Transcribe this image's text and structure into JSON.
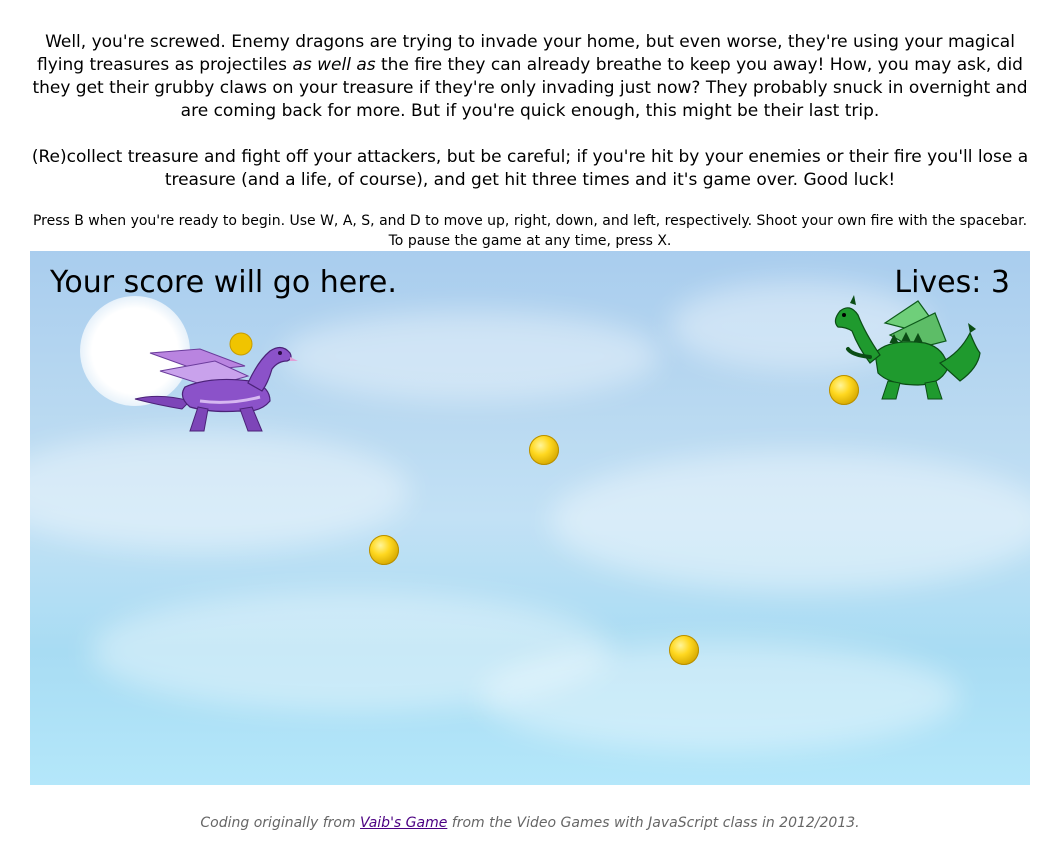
{
  "intro": {
    "p1_before": "Well, you're screwed. Enemy dragons are trying to invade your home, but even worse, they're using your magical flying treasures as projectiles ",
    "p1_emphasis": "as well as",
    "p1_after": " the fire they can already breathe to keep you away! How, you may ask, did they get their grubby claws on your treasure if they're only invading just now? They probably snuck in overnight and are coming back for more. But if you're quick enough, this might be their last trip.",
    "p2": "(Re)collect treasure and fight off your attackers, but be careful; if you're hit by your enemies or their fire you'll lose a treasure (and a life, of course), and get hit three times and it's game over. Good luck!",
    "p3": "Press B when you're ready to begin. Use W, A, S, and D to move up, right, down, and left, respectively. Shoot your own fire with the spacebar. To pause the game at any time, press X."
  },
  "game": {
    "score_text": "Your score will go here.",
    "lives_text": "Lives: 3",
    "player": {
      "name": "purple-dragon",
      "color": "#8b52c9"
    },
    "enemy": {
      "name": "green-dragon",
      "color": "#1f9a2e"
    },
    "coin_color": "#f2c500",
    "coins": 5
  },
  "footer": {
    "before": "Coding originally from ",
    "link_text": "Vaib's Game",
    "after": " from the Video Games with JavaScript class in 2012/2013."
  }
}
